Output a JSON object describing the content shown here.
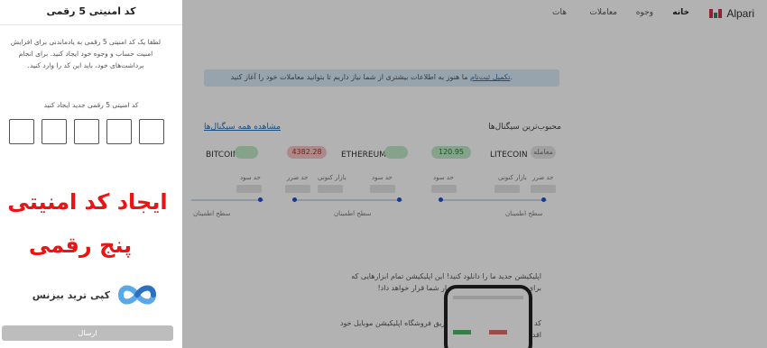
{
  "nav": {
    "logo": "Alpari",
    "items": [
      "خانه",
      "وجوه",
      "معاملات",
      "هات"
    ]
  },
  "alert": {
    "text": "ما هنوز به اطلاعات بیشتری از شما نیاز داریم تا بتوانید معاملات خود را آغاز کنید.",
    "link": "تکمیل ثبت‌نام"
  },
  "sections": {
    "popular": "محبوب‌ترین سیگنال‌ها",
    "view_all": "مشاهده همه سیگنال‌ها"
  },
  "tickers": [
    {
      "name": "LITECOIN",
      "price": "120.95",
      "badge": "معامله",
      "trend": "up"
    },
    {
      "name": "ETHEREUM",
      "price": "",
      "badge": "",
      "trend": "up"
    },
    {
      "name": "BITCOIN",
      "price": "4382.28",
      "badge": "",
      "trend": "down"
    }
  ],
  "ticker_labels": {
    "close": "حد ضرر",
    "target": "حد سود",
    "current": "بازار کنونی",
    "support": "سطح اطمینان"
  },
  "promo": {
    "line1": "اپلیکیشن جدید ما را دانلود کنید! این اپلیکیشن تمام ابزارهایی که",
    "line2": "برای معامله نیاز دارید را در اختیار شما قرار خواهد داد!",
    "line3": "کد QR زیر را اسکن کنید یا از طریق فروشگاه اپلیکیشن موبایل خود",
    "line4": "اقدام به دانلود این برنامه کنید"
  },
  "panel": {
    "title": "کد امنیتی 5 رقمی",
    "description": "لطفا یک کد امنیتی 5 رقمی به یادماندنی برای افزایش امنیت حساب و وجوه خود ایجاد کنید. برای انجام برداشت‌های خود، باید این کد را وارد کنید.",
    "code_label": "کد امنیتی 5 رقمی جدید ایجاد کنید",
    "headline1": "ایجاد کد امنیتی",
    "headline2": "پنج رقمی",
    "brand": "کپی ترید بیزنس",
    "submit": "ارسال"
  },
  "colors": {
    "headline": "#ee1212",
    "overlay": "rgba(0,0,0,0.30)",
    "up": "#bfe8c8",
    "down": "#f7c6c6",
    "link": "#2b6cb0"
  }
}
